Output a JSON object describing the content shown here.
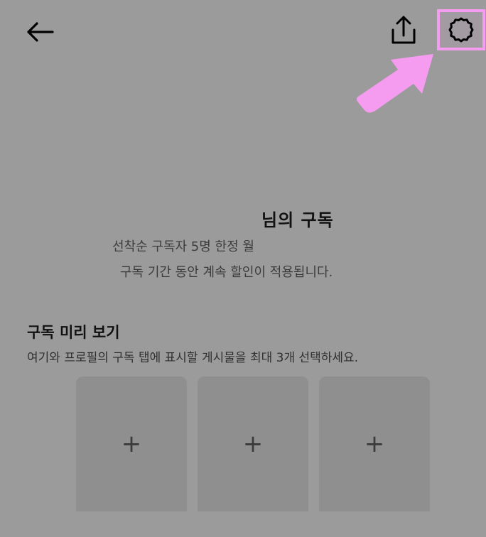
{
  "header": {
    "back_icon": "arrow-left-icon",
    "share_icon": "share-upload-icon",
    "settings_icon": "gear-icon",
    "highlight_color": "#f59cf0"
  },
  "subscription": {
    "title": "님의 구독",
    "line1": "선착순 구독자 5명 한정 월",
    "line2": "구독 기간 동안 계속 할인이 적용됩니다."
  },
  "preview": {
    "title": "구독 미리 보기",
    "description": "여기와 프로필의 구독 탭에 표시할 게시물을 최대 3개 선택하세요.",
    "slots": [
      {
        "label": "+"
      },
      {
        "label": "+"
      },
      {
        "label": "+"
      }
    ]
  },
  "colors": {
    "background": "#9b9b9b",
    "slot": "#8f8f8f",
    "annotation": "#f59cf0"
  }
}
